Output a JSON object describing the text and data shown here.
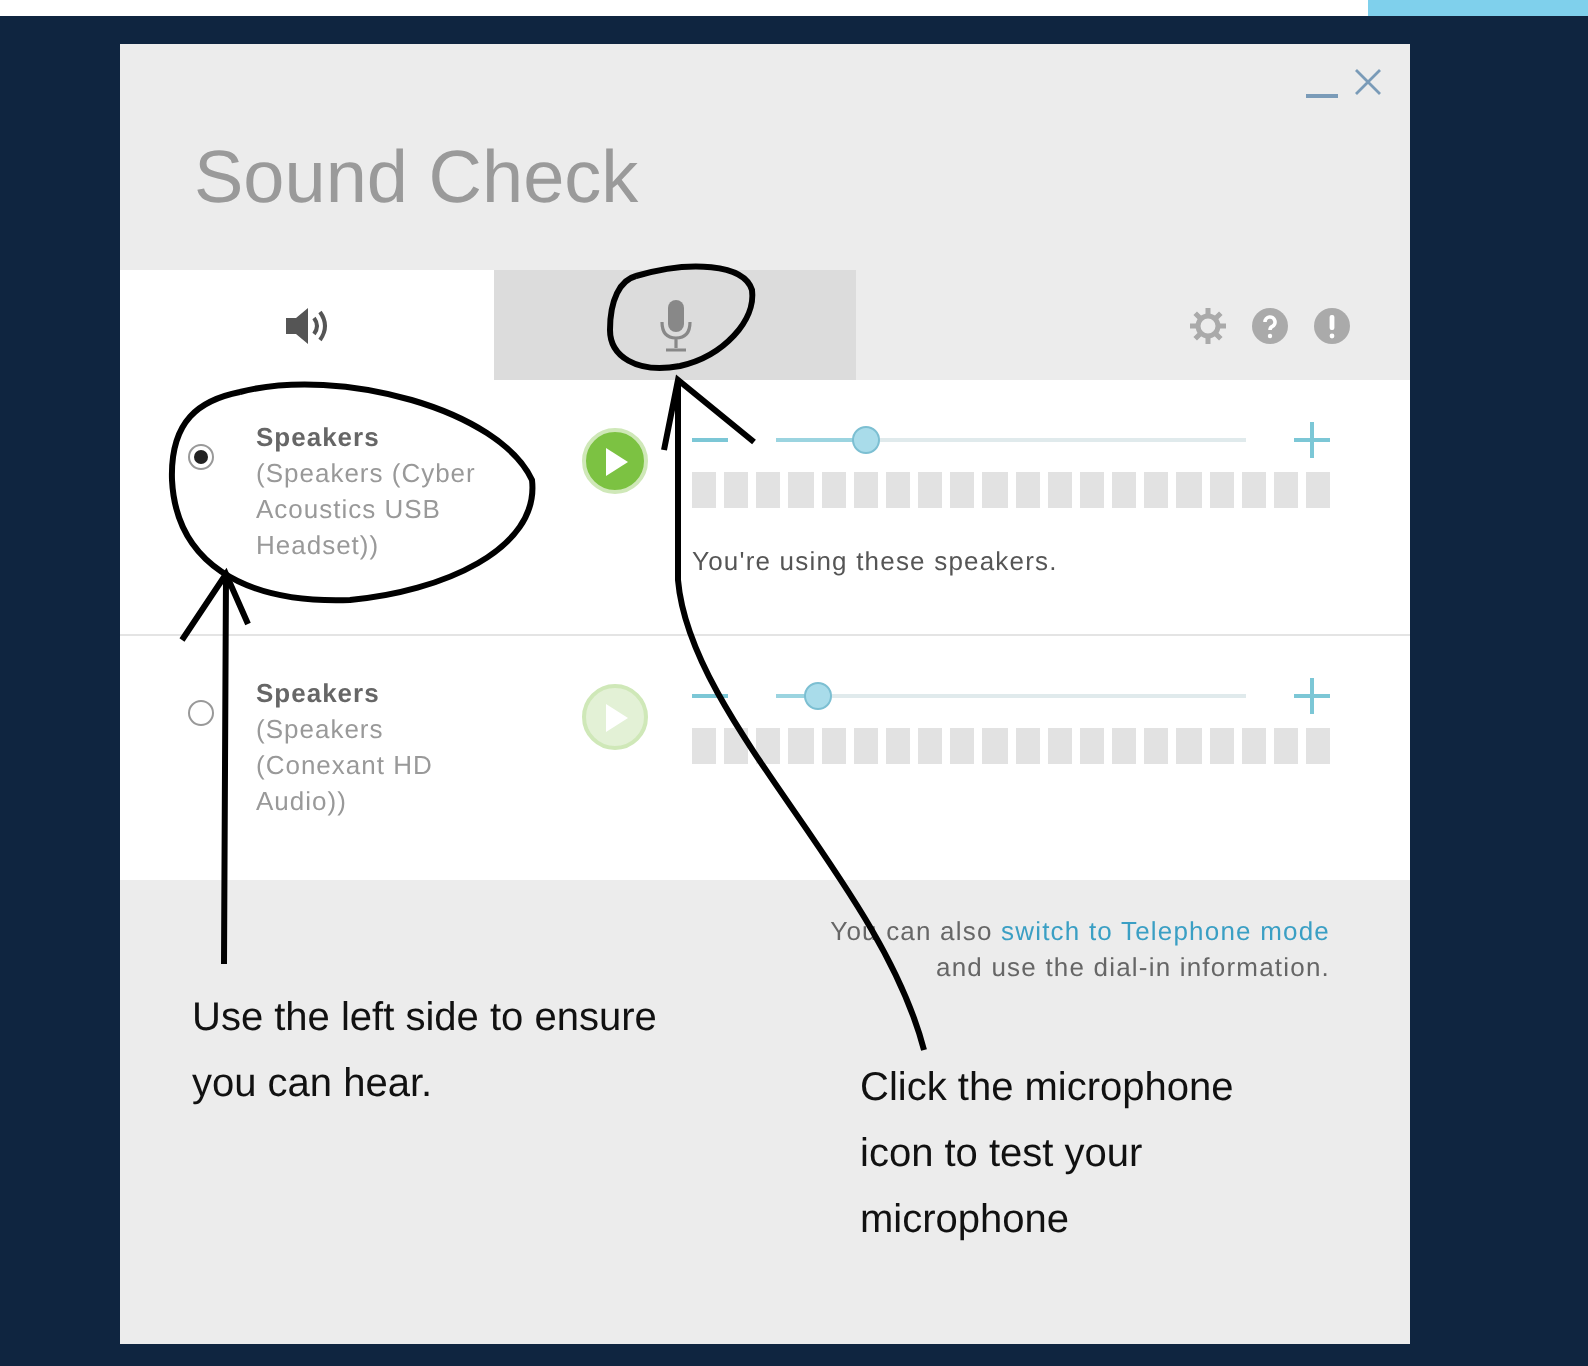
{
  "window": {
    "title": "Sound Check"
  },
  "tabs": [
    {
      "kind": "speaker",
      "selected": true
    },
    {
      "kind": "microphone",
      "selected": false
    }
  ],
  "devices": [
    {
      "name": "Speakers",
      "detail": "(Speakers (Cyber Acoustics USB Headset))",
      "selected": true,
      "play_enabled": true,
      "level": 0.19,
      "message": "You're using these speakers."
    },
    {
      "name": "Speakers",
      "detail": "(Speakers (Conexant HD Audio))",
      "selected": false,
      "play_enabled": false,
      "level": 0.09
    }
  ],
  "footer": {
    "text_before": "You can also",
    "link": "switch to Telephone mode",
    "text_after": "and use the dial-in information."
  },
  "annotations": [
    {
      "text": "Use the left side to ensure you can hear."
    },
    {
      "text": "Click the microphone icon to test your microphone"
    }
  ]
}
